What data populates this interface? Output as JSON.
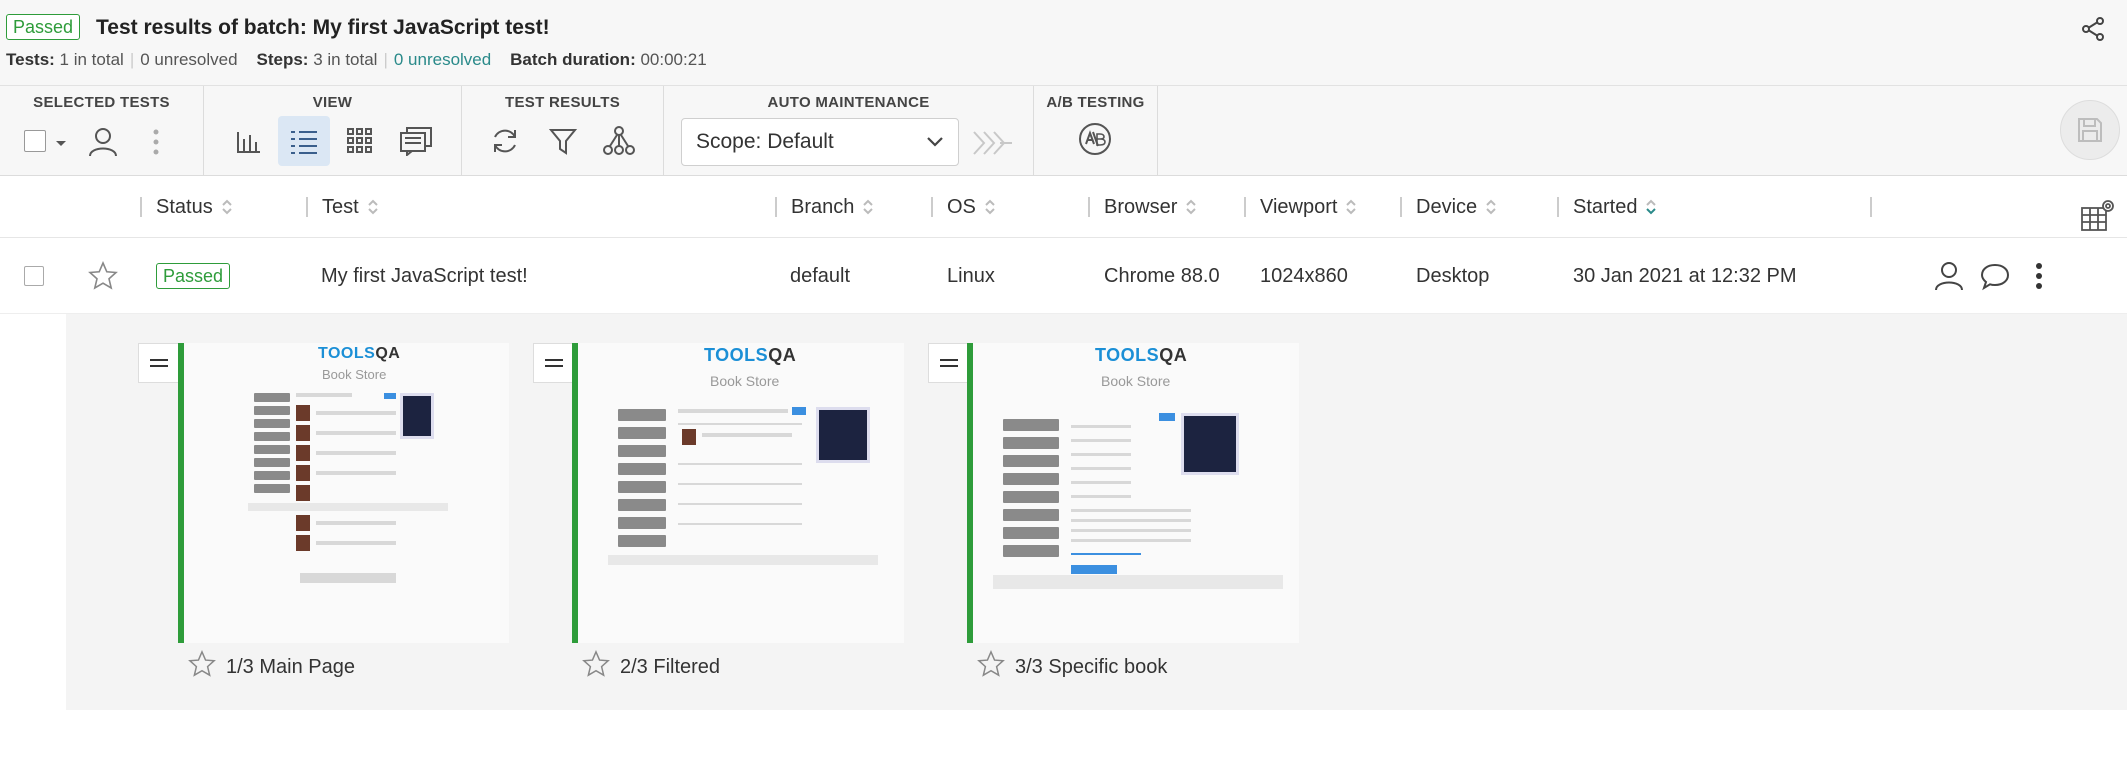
{
  "header": {
    "status_badge": "Passed",
    "title": "Test results of batch: My first JavaScript test!",
    "tests_label": "Tests:",
    "tests_total": "1 in total",
    "tests_unresolved": "0 unresolved",
    "steps_label": "Steps:",
    "steps_total": "3 in total",
    "steps_unresolved": "0 unresolved",
    "duration_label": "Batch duration:",
    "duration_value": "00:00:21"
  },
  "toolbar": {
    "groups": {
      "selected_tests": "SELECTED TESTS",
      "view": "VIEW",
      "test_results": "TEST RESULTS",
      "auto_maintenance": "AUTO MAINTENANCE",
      "ab_testing": "A/B TESTING"
    },
    "scope_select": "Scope: Default",
    "active_view": "list"
  },
  "table": {
    "columns": [
      "Status",
      "Test",
      "Branch",
      "OS",
      "Browser",
      "Viewport",
      "Device",
      "Started"
    ],
    "sorted_column": "Started",
    "rows": [
      {
        "status": "Passed",
        "test": "My first JavaScript test!",
        "branch": "default",
        "os": "Linux",
        "browser": "Chrome 88.0",
        "viewport": "1024x860",
        "device": "Desktop",
        "started": "30 Jan 2021 at 12:32 PM"
      }
    ]
  },
  "steps": [
    {
      "label": "1/3 Main Page"
    },
    {
      "label": "2/3 Filtered"
    },
    {
      "label": "3/3 Specific book"
    }
  ],
  "thumbnail": {
    "logo_left": "TOOLS",
    "logo_right": "QA",
    "subtitle": "Book Store"
  },
  "colors": {
    "passed": "#2e9c3a",
    "accent_link": "#2a8a8a",
    "active_view_bg": "#dbe7f4"
  }
}
